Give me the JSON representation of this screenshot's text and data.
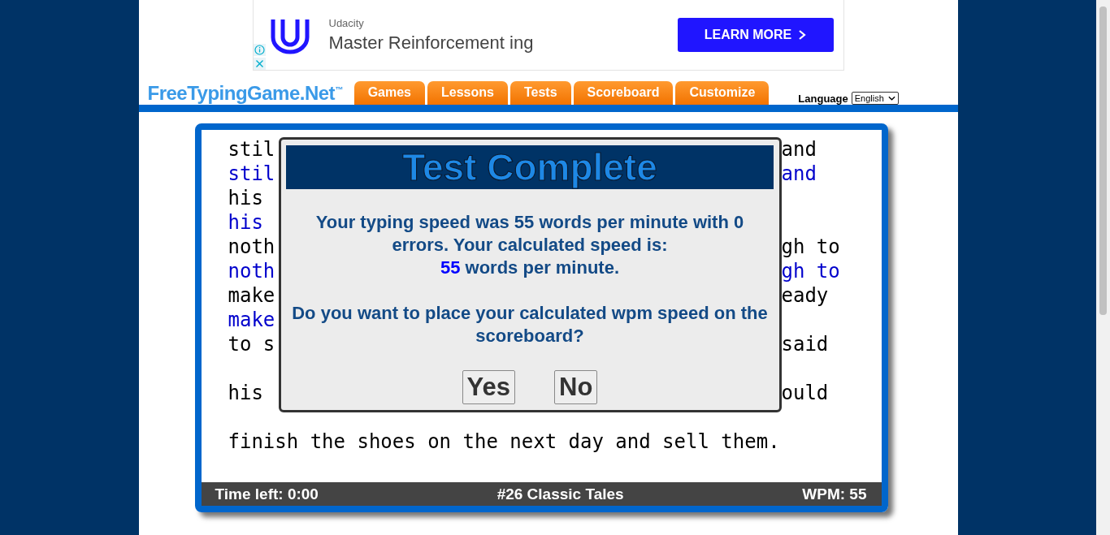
{
  "ad": {
    "advertiser": "Udacity",
    "headline": "Master Reinforcement ing",
    "button": "LEARN MORE"
  },
  "logo": {
    "name": "FreeTypingGame.Net",
    "mark": "™"
  },
  "nav": [
    {
      "label": "Games"
    },
    {
      "label": "Lessons"
    },
    {
      "label": "Tests"
    },
    {
      "label": "Scoreboard"
    },
    {
      "label": "Customize"
    }
  ],
  "language": {
    "label": "Language",
    "value": "English"
  },
  "text_lines": [
    {
      "kind": "text",
      "left": "stil",
      "right": "and",
      "typed": false
    },
    {
      "kind": "text",
      "left": "stil",
      "right": "and",
      "typed": true
    },
    {
      "kind": "text",
      "left": "his",
      "typed": false
    },
    {
      "kind": "text",
      "left": "his",
      "typed": true
    },
    {
      "kind": "text",
      "left": "noth",
      "right": "gh to",
      "typed": false
    },
    {
      "kind": "text",
      "left": "noth",
      "right": "gh to",
      "typed": true
    },
    {
      "kind": "text",
      "left": "make",
      "right": "eady",
      "typed": false
    },
    {
      "kind": "text",
      "left": "make",
      "typed": true
    },
    {
      "kind": "text",
      "left": "to s",
      "right": "said",
      "typed": false
    },
    {
      "kind": "blank"
    },
    {
      "kind": "text",
      "left": "his",
      "right": "ould",
      "typed": false
    },
    {
      "kind": "blank"
    },
    {
      "kind": "text",
      "left": "finish the shoes on the next day and sell them.",
      "typed": false
    }
  ],
  "dialog": {
    "title": "Test Complete",
    "message": "Your typing speed was 55 words per minute with 0 errors. Your calculated speed is:",
    "calculated_wpm": "55",
    "wpm_suffix": "words per minute.",
    "question": "Do you want to place your calculated wpm speed on the scoreboard?",
    "buttons": [
      "Yes",
      "No"
    ]
  },
  "status_bar": {
    "time_left": "Time left: 0:00",
    "test_name": "#26 Classic Tales",
    "wpm": "WPM: 55"
  }
}
